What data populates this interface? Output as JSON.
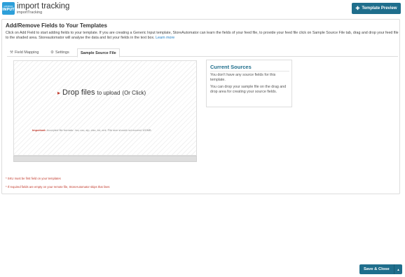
{
  "header": {
    "logo_line1": "GENERIC",
    "logo_line2": "INPUT",
    "title": "import tracking",
    "subtitle": "importTracking",
    "preview_label": "Template Preview"
  },
  "panel": {
    "title": "Add/Remove Fields to Your Templates",
    "description": "Click on Add Field to start adding fields to your template. If you are creating a Generic Input template, StoreAutomator can learn the fields of your feed file, to provide your feed file click on Sample Source File tab, drag and drop your feed file to the shaded area. Storeautomator will analyse the data and list your fields in the text box.",
    "learn_more": "Learn more"
  },
  "tabs": [
    {
      "label": "Field Mapping",
      "icon": "wrench-icon"
    },
    {
      "label": "Settings",
      "icon": "gear-icon"
    },
    {
      "label": "Sample Source File",
      "icon": ""
    }
  ],
  "dropzone": {
    "drop_label": "Drop files",
    "upload_label": "to upload",
    "click_label": "(Or Click)",
    "important_label": "Important:",
    "note": "Accepted file formats: .tsv,.csv,.zip,.xlsx,.txt,.xml. File size should not exceed 100MB"
  },
  "sources": {
    "title": "Current Sources",
    "line1": "You don't have any source fields for this template.",
    "line2": "You can drop your sample file on the drag and drop area for creating your source fields."
  },
  "warnings": {
    "w1": "* SKU must be first field on your templates",
    "w2": "* If required fields are empty on your remote file, StoreAutomator skips that lines"
  },
  "footer": {
    "save_label": "Save & Close"
  },
  "colors": {
    "accent": "#1f6e8c",
    "logo": "#2d9fd9",
    "warning": "#c0392b",
    "link": "#1c7bc0"
  }
}
